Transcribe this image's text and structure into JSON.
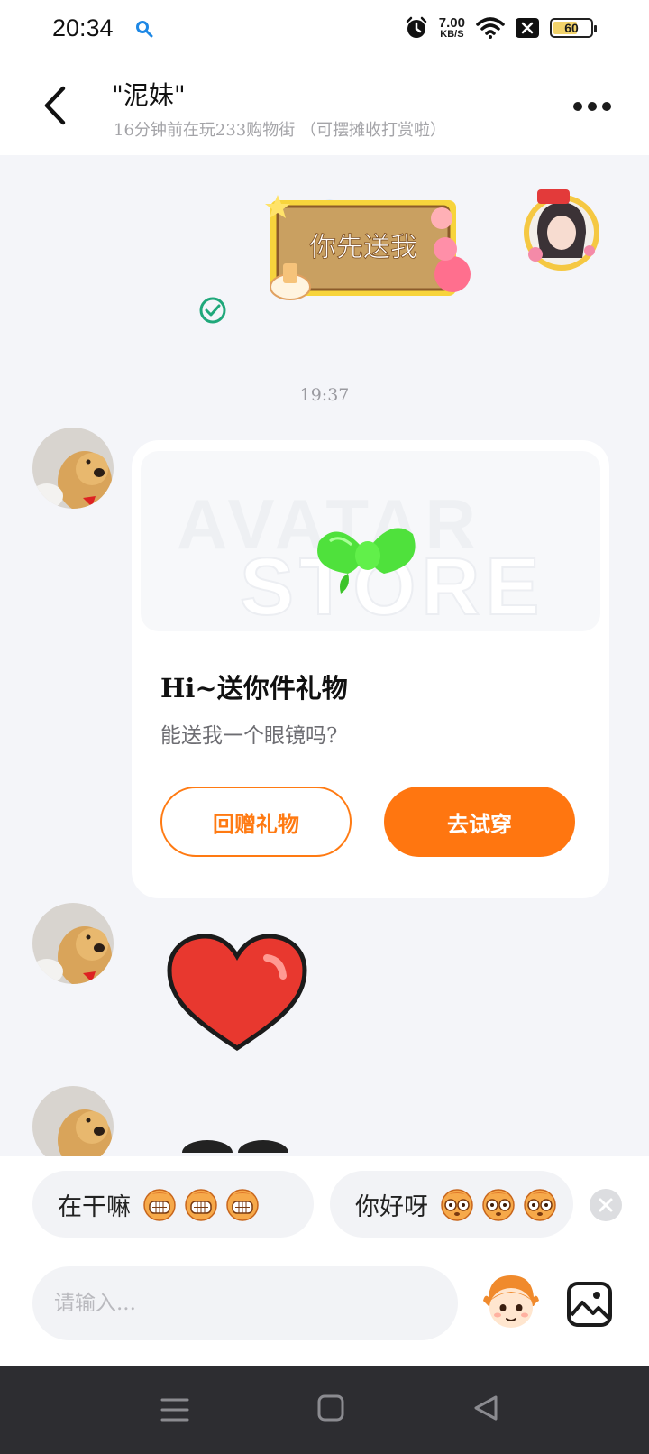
{
  "status_bar": {
    "time": "20:34",
    "net_speed": "7.00",
    "net_unit": "KB/S",
    "battery": "60"
  },
  "header": {
    "title": "\"泥妹\"",
    "subtitle": "16分钟前在玩233购物街 （可摆摊收打赏啦）"
  },
  "messages": {
    "sent_sticker_text": "你先送我",
    "timestamp": "19:37",
    "gift_card": {
      "banner_watermark_1": "AVATAR",
      "banner_watermark_2": "STORE",
      "title": "Hi~送你件礼物",
      "description": "能送我一个眼镜吗?",
      "return_button": "回赠礼物",
      "try_button": "去试穿"
    }
  },
  "quick_replies": [
    {
      "label": "在干嘛"
    },
    {
      "label": "你好呀"
    }
  ],
  "composer": {
    "placeholder": "请输入..."
  },
  "colors": {
    "accent": "#ff7610",
    "background": "#f4f5f9"
  }
}
